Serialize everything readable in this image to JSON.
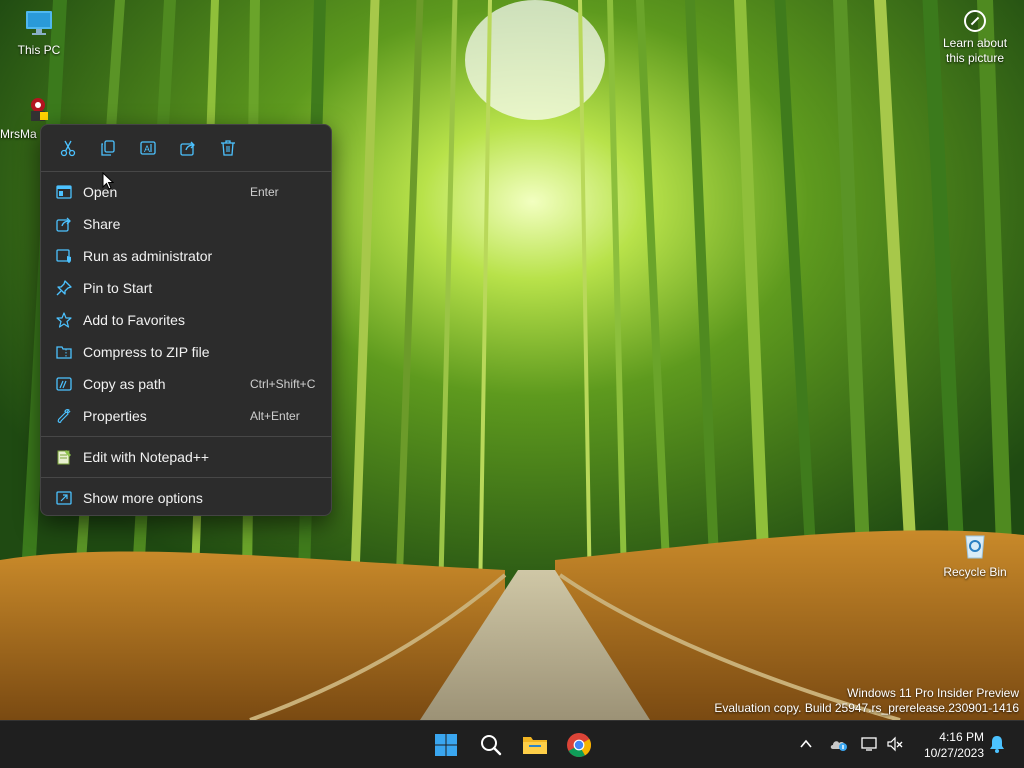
{
  "desktop": {
    "icons": {
      "this_pc": "This PC",
      "mrsmaj": "MrsMa",
      "recycle_bin": "Recycle Bin"
    },
    "learn_about": [
      "Learn about",
      "this picture"
    ],
    "watermark": [
      "Windows 11 Pro Insider Preview",
      "Evaluation copy. Build 25947.rs_prerelease.230901-1416"
    ]
  },
  "context_menu": {
    "quick_actions": [
      {
        "name": "cut",
        "icon": "scissors-icon"
      },
      {
        "name": "copy",
        "icon": "copy-icon"
      },
      {
        "name": "rename",
        "icon": "rename-icon"
      },
      {
        "name": "share",
        "icon": "share-icon"
      },
      {
        "name": "delete",
        "icon": "trash-icon"
      }
    ],
    "items": [
      {
        "label": "Open",
        "shortcut": "Enter",
        "icon": "window-icon"
      },
      {
        "label": "Share",
        "shortcut": "",
        "icon": "share-icon"
      },
      {
        "label": "Run as administrator",
        "shortcut": "",
        "icon": "shield-icon"
      },
      {
        "label": "Pin to Start",
        "shortcut": "",
        "icon": "pin-icon"
      },
      {
        "label": "Add to Favorites",
        "shortcut": "",
        "icon": "star-icon"
      },
      {
        "label": "Compress to ZIP file",
        "shortcut": "",
        "icon": "zip-folder-icon"
      },
      {
        "label": "Copy as path",
        "shortcut": "Ctrl+Shift+C",
        "icon": "path-icon"
      },
      {
        "label": "Properties",
        "shortcut": "Alt+Enter",
        "icon": "wrench-icon"
      },
      {
        "label": "Edit with Notepad++",
        "shortcut": "",
        "icon": "notepadpp-icon"
      },
      {
        "label": "Show more options",
        "shortcut": "",
        "icon": "more-options-icon"
      }
    ]
  },
  "taskbar": {
    "apps": [
      "start",
      "search",
      "file-explorer",
      "chrome"
    ],
    "clock": {
      "time": "4:16 PM",
      "date": "10/27/2023"
    }
  },
  "colors": {
    "menu_bg": "#2c2c2c",
    "accent": "#4cc2ff",
    "taskbar_bg": "#1f1f1f"
  }
}
